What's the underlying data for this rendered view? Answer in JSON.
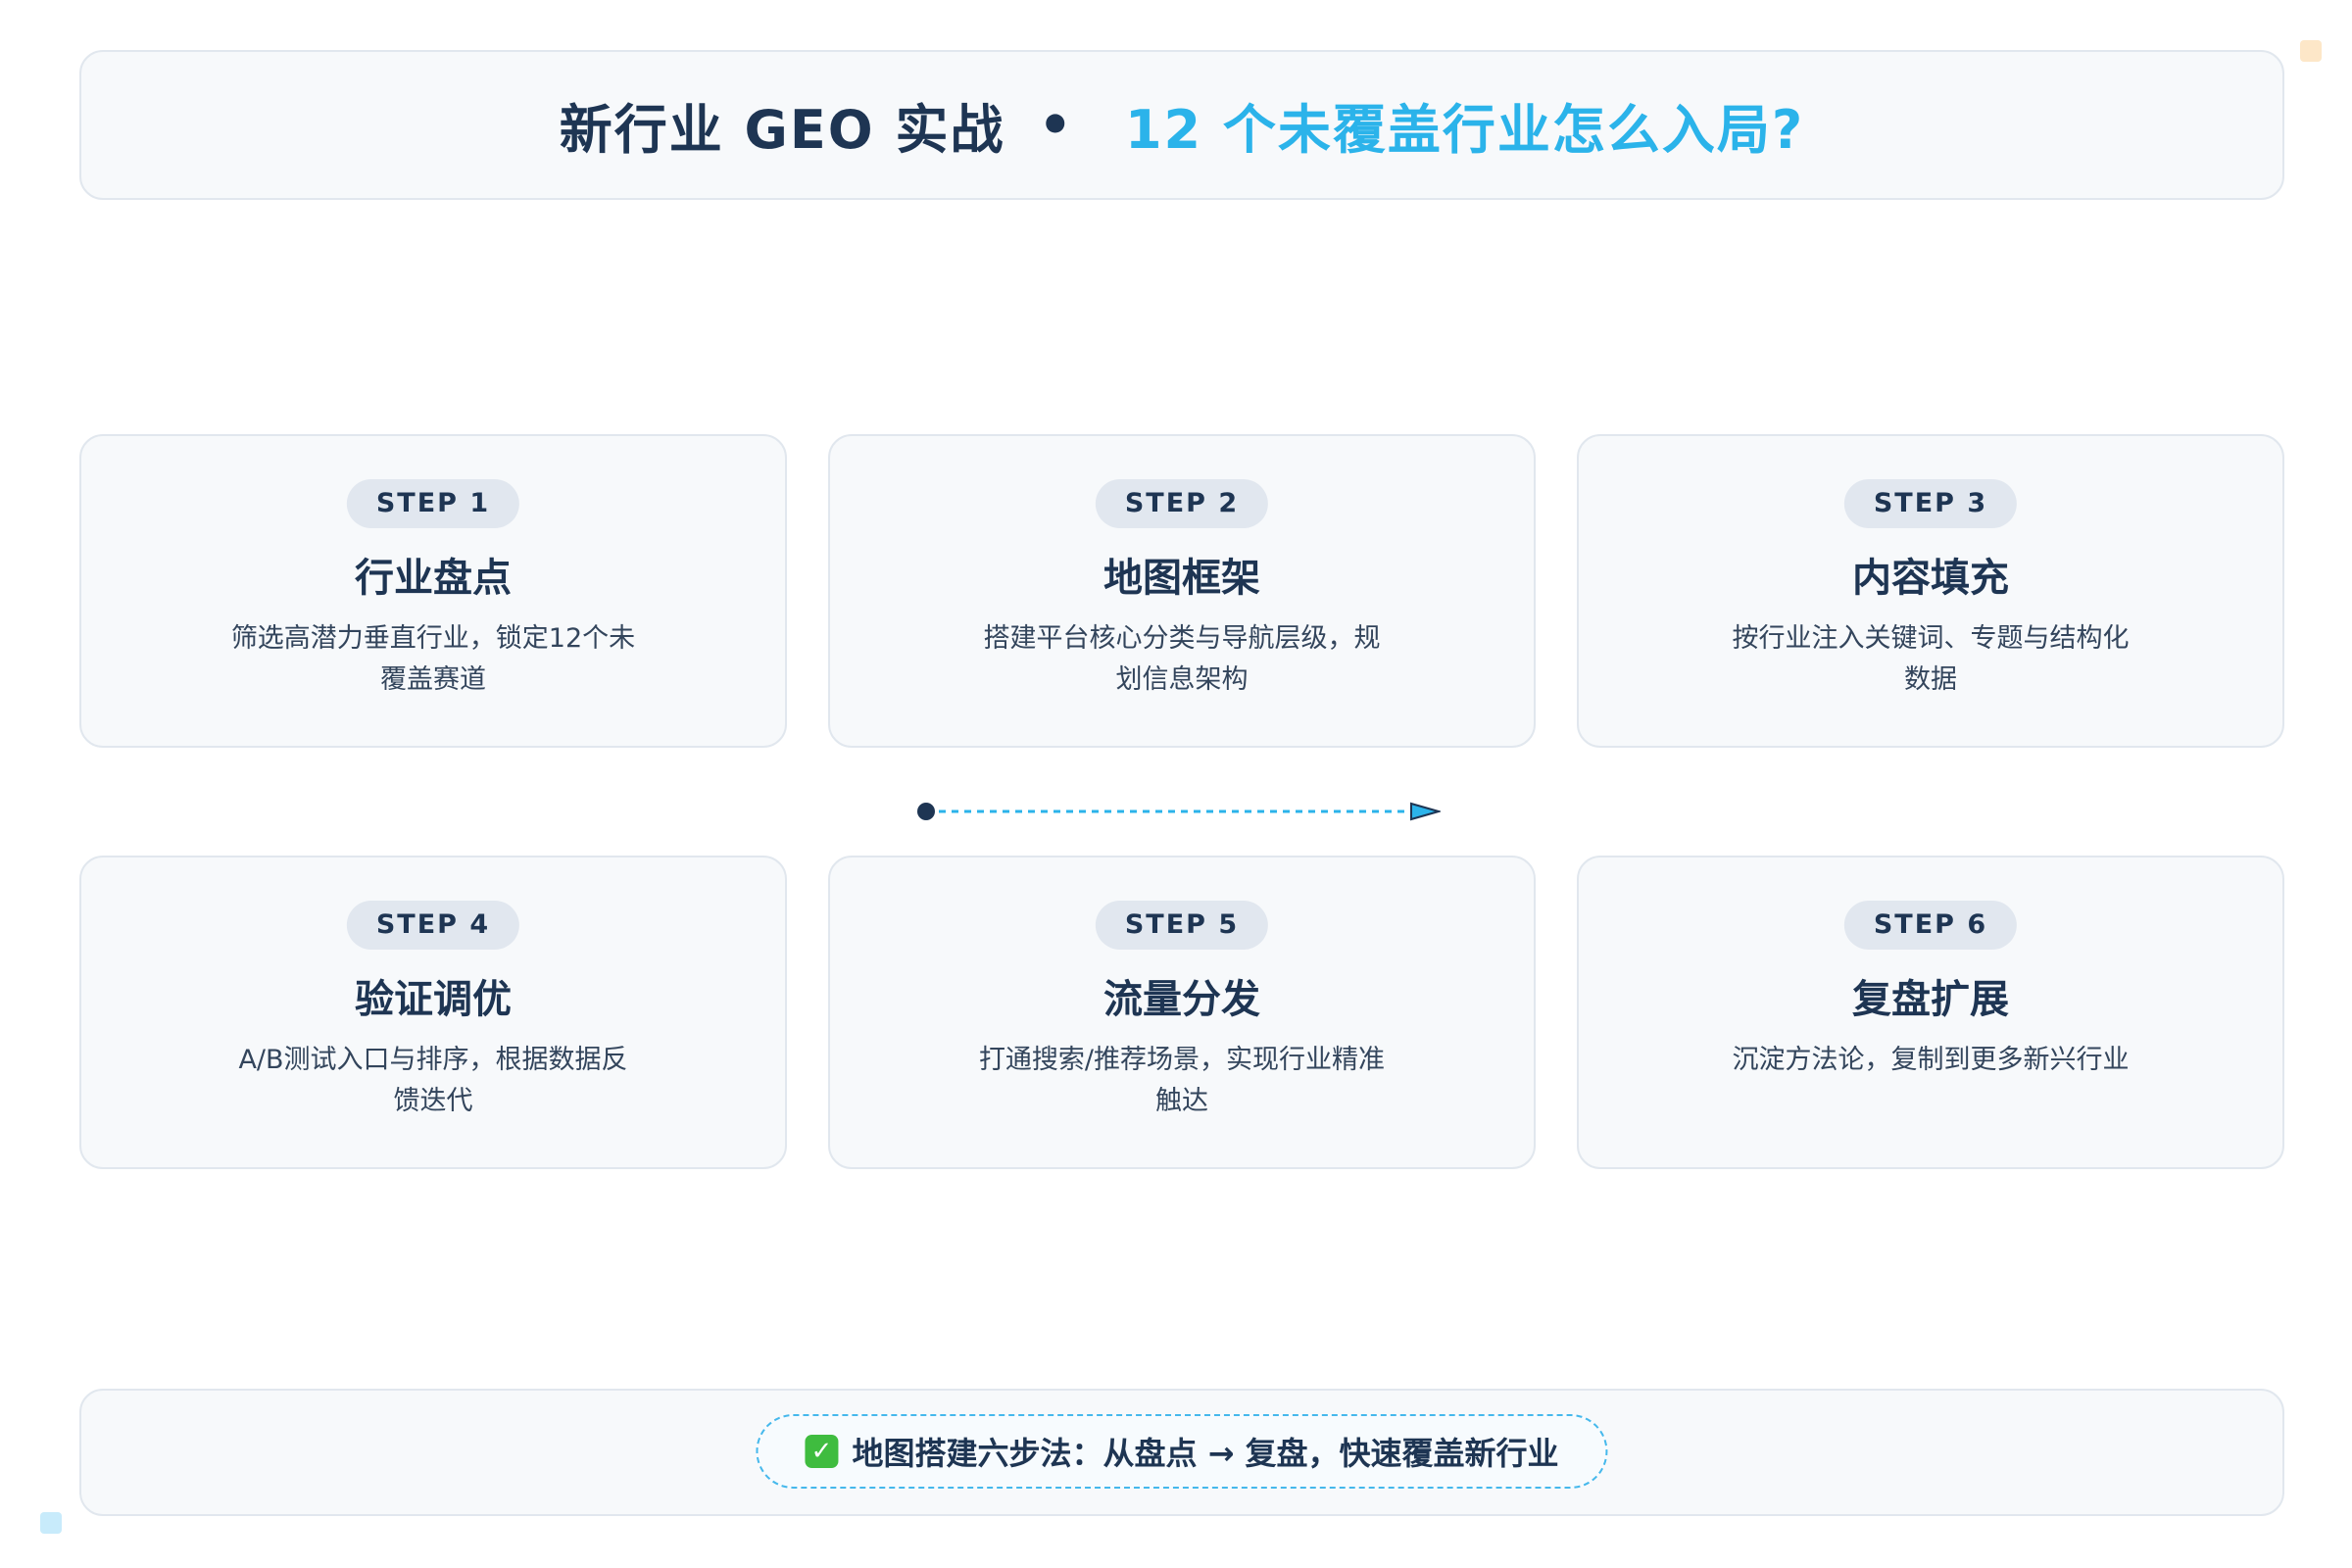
{
  "header": {
    "title_main": "新行业 GEO 实战",
    "separator": "•",
    "title_accent": "12 个未覆盖行业怎么入局?"
  },
  "steps": [
    {
      "badge": "STEP 1",
      "title": "行业盘点",
      "desc": "筛选高潜力垂直行业，锁定12个未覆盖赛道"
    },
    {
      "badge": "STEP 2",
      "title": "地图框架",
      "desc": "搭建平台核心分类与导航层级，规划信息架构"
    },
    {
      "badge": "STEP 3",
      "title": "内容填充",
      "desc": "按行业注入关键词、专题与结构化数据"
    },
    {
      "badge": "STEP 4",
      "title": "验证调优",
      "desc": "A/B测试入口与排序，根据数据反馈迭代"
    },
    {
      "badge": "STEP 5",
      "title": "流量分发",
      "desc": "打通搜索/推荐场景，实现行业精准触达"
    },
    {
      "badge": "STEP 6",
      "title": "复盘扩展",
      "desc": "沉淀方法论，复制到更多新兴行业"
    }
  ],
  "footer": {
    "icon": "check-icon",
    "summary": "地图搭建六步法：从盘点 → 复盘，快速覆盖新行业"
  },
  "colors": {
    "primary_text": "#1e3553",
    "accent": "#2bb3ea",
    "card_bg": "#f7f9fb",
    "card_border": "#e1e7ee",
    "badge_bg": "#e1e7ef",
    "check_green": "#3fbc3f"
  }
}
